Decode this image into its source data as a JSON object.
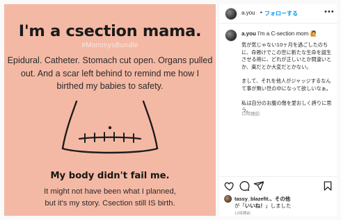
{
  "post_image": {
    "title": "I'm a csection mama.",
    "hashtag": "#MommysBundle",
    "paragraph": "Epidural. Catheter. Stomach cut open. Organs pulled out. And a scar left behind to remind me how I birthed my babies to safety.",
    "bold_line": "My body didn't fail me.",
    "footer_line1": "It might not have been what I planned,",
    "footer_line2": "but it's my story. Csection still IS birth.",
    "background_color": "#f4b9a4"
  },
  "header": {
    "username": "a.you",
    "separator": "•",
    "follow_label": "フォローする",
    "more_icon": "more-horizontal-icon"
  },
  "caption": {
    "username": "a.you",
    "headline": "I'm a C-section mom",
    "emoji": "🙋",
    "paragraph1": "気が気じゃない10ヶ月を過ごしたのちに、命懸けでこの世に新たな生命を誕生させる術に、どれが正しいとか間違いとか、楽だとか大変だとかない。",
    "paragraph2": "まして、それを他人がジャッジするなんて事が無い世の中になって欲しいなぁ。",
    "paragraph3": "私は自分のお腹の傷を愛おしく誇りに思う。",
    "time": "12時間前"
  },
  "actions": {
    "icons": [
      "heart-icon",
      "comment-icon",
      "share-icon",
      "bookmark-icon"
    ]
  },
  "likes": {
    "liker": "tassy_blazefit.",
    "suffix": "、その他",
    "line2_prefix": "が「",
    "line2_link": "いいね！",
    "line2_suffix": "」しました",
    "time": "12時間前"
  },
  "colors": {
    "accent_blue": "#0095f6",
    "border": "#efefef",
    "muted": "#8e8e8e"
  }
}
